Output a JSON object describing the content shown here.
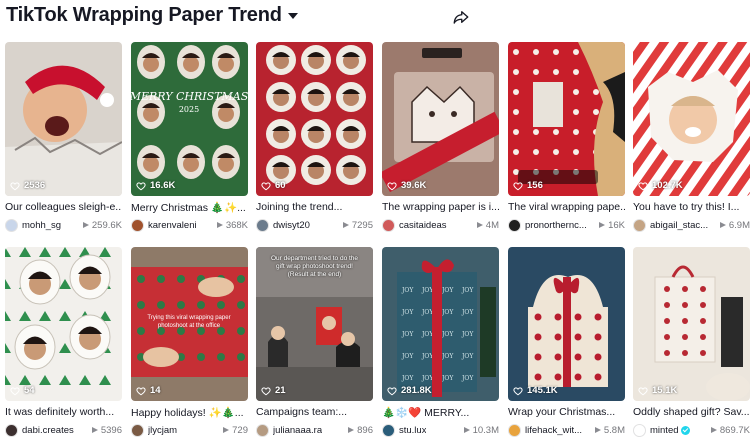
{
  "header": {
    "title": "TikTok Wrapping Paper Trend",
    "title_icon": "chevron-down-icon",
    "share_icon": "share-icon"
  },
  "cards": [
    {
      "likes": "2536",
      "caption": "Our colleagues sleigh-e...",
      "author": "mohh_sg",
      "views": "259.6K",
      "avatar_color": "#c9d6ea",
      "bg": "#d9d3cc",
      "accent": "#c8102e"
    },
    {
      "likes": "16.6K",
      "caption": "Merry Christmas 🎄✨...",
      "author": "karenvaleni",
      "views": "368K",
      "avatar_color": "#a0522d",
      "bg": "#2e6b3a",
      "accent": "#d7263d"
    },
    {
      "likes": "60",
      "caption": "Joining the trend...",
      "author": "dwisyt20",
      "views": "7295",
      "avatar_color": "#6b7b8c",
      "bg": "#b8232f",
      "accent": "#f2d7a3"
    },
    {
      "likes": "39.6K",
      "caption": "The wrapping paper is i...",
      "author": "casitaideas",
      "views": "4M",
      "avatar_color": "#d05a5a",
      "bg": "#9c7a6d",
      "accent": "#c61e2e"
    },
    {
      "likes": "156",
      "caption": "The viral wrapping pape...",
      "author": "pronorthernc...",
      "views": "16K",
      "avatar_color": "#1f1f1f",
      "bg": "#c81e2a",
      "accent": "#f5f0e8"
    },
    {
      "likes": "102.7K",
      "caption": "You have to try this! I...",
      "author": "abigail_stac...",
      "views": "6.9M",
      "avatar_color": "#c4a484",
      "bg": "#e03b3b",
      "accent": "#ffffff"
    },
    {
      "likes": "54",
      "caption": "It was definitely worth...",
      "author": "dabi.creates",
      "views": "5396",
      "avatar_color": "#3c2f2f",
      "bg": "#f2f0ec",
      "accent": "#2f8f4e"
    },
    {
      "likes": "14",
      "caption": "Happy holidays! ✨🎄...",
      "author": "jlycjam",
      "views": "729",
      "avatar_color": "#7a5a44",
      "bg": "#c62f35",
      "accent": "#2d7a46"
    },
    {
      "likes": "21",
      "caption": "Campaigns team:...",
      "author": "julianaaa.ra",
      "views": "896",
      "avatar_color": "#b59b82",
      "bg": "#6e6a67",
      "accent": "#cf2b2b",
      "overlay_text": "Our department tried to do the gift wrap photoshoot trend! (Result at the end)"
    },
    {
      "likes": "281.8K",
      "caption": "🎄❄️❤️ MERRY...",
      "author": "stu.lux",
      "views": "10.3M",
      "avatar_color": "#2a5d7a",
      "bg": "#3f5e6b",
      "accent": "#c41f2f"
    },
    {
      "likes": "145.1K",
      "caption": "Wrap your Christmas...",
      "author": "lifehack_wit...",
      "views": "5.8M",
      "avatar_color": "#e8a33d",
      "bg": "#2a4a63",
      "accent": "#b81d2e"
    },
    {
      "likes": "15.1K",
      "caption": "Oddly shaped gift? Sav...",
      "author": "minted",
      "views": "869.7K",
      "avatar_color": "#ffffff",
      "bg": "#ece6dd",
      "accent": "#b82933",
      "verified": true
    }
  ],
  "icons": {
    "like": "heart-icon",
    "views": "play-icon"
  }
}
